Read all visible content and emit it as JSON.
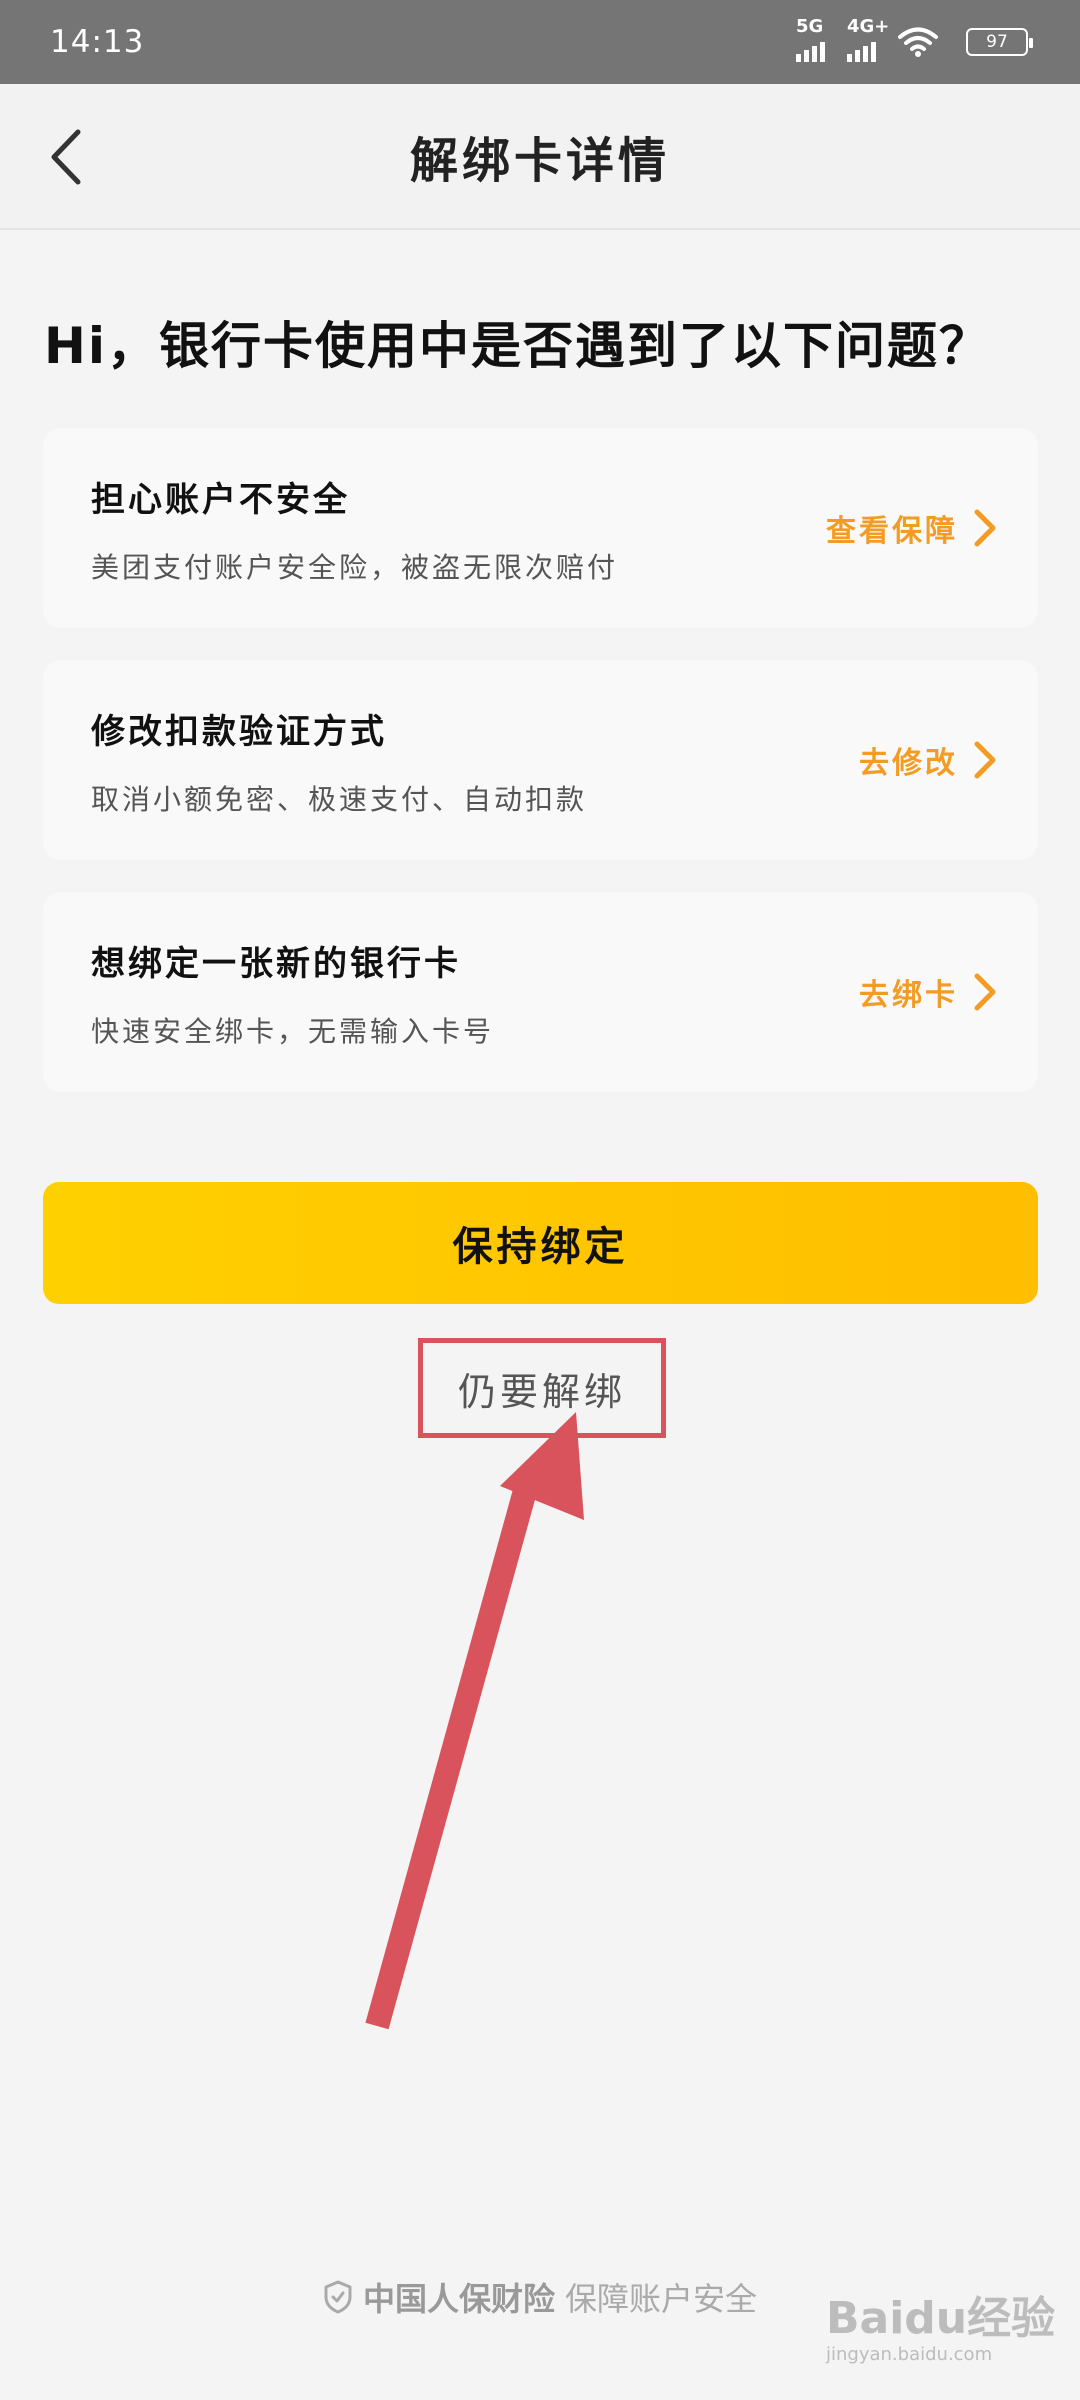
{
  "status_bar": {
    "time": "14:13",
    "network_1": "5G",
    "network_2": "4G+",
    "battery": "97",
    "icons": [
      "signal-icon",
      "wifi-icon",
      "battery-icon"
    ]
  },
  "nav": {
    "title": "解绑卡详情",
    "back_icon": "chevron-left-icon"
  },
  "heading": "Hi，银行卡使用中是否遇到了以下问题？",
  "cards": [
    {
      "title": "担心账户不安全",
      "desc": "美团支付账户安全险，被盗无限次赔付",
      "action": "查看保障"
    },
    {
      "title": "修改扣款验证方式",
      "desc": "取消小额免密、极速支付、自动扣款",
      "action": "去修改"
    },
    {
      "title": "想绑定一张新的银行卡",
      "desc": "快速安全绑卡，无需输入卡号",
      "action": "去绑卡"
    }
  ],
  "buttons": {
    "keep": "保持绑定",
    "unbind": "仍要解绑"
  },
  "footer": {
    "brand": "中国人保财险",
    "slogan": "保障账户安全",
    "icon": "shield-icon"
  },
  "watermark": {
    "text": "Baidu经验",
    "sub": "jingyan.baidu.com"
  },
  "colors": {
    "accent": "#f39c24",
    "primary_button": "#ffc800",
    "annotation": "#d9535d",
    "status_bar": "#757575",
    "background": "#f4f4f4"
  }
}
